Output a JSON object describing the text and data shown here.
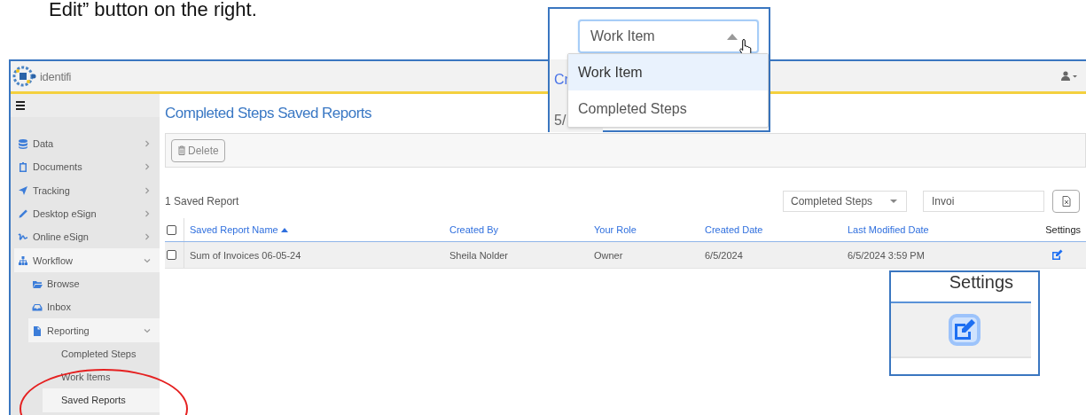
{
  "instruction_text": "Edit” button on the right.",
  "app": {
    "logo_text": "identifi",
    "sidebar": {
      "items": [
        {
          "label": "Data",
          "expanded": false,
          "selected": false
        },
        {
          "label": "Documents",
          "expanded": false,
          "selected": false
        },
        {
          "label": "Tracking",
          "expanded": false,
          "selected": false
        },
        {
          "label": "Desktop eSign",
          "expanded": false,
          "selected": false
        },
        {
          "label": "Online eSign",
          "expanded": false,
          "selected": false
        },
        {
          "label": "Workflow",
          "expanded": true,
          "selected": false,
          "children": [
            {
              "label": "Browse",
              "selected": false
            },
            {
              "label": "Inbox",
              "selected": false
            },
            {
              "label": "Reporting",
              "expanded": true,
              "selected": false,
              "children": [
                {
                  "label": "Completed Steps",
                  "selected": false
                },
                {
                  "label": "Work Items",
                  "selected": false
                },
                {
                  "label": "Saved Reports",
                  "selected": true
                }
              ]
            }
          ]
        }
      ]
    },
    "page_title": "Completed Steps Saved Reports",
    "toolbar": {
      "buttons": [
        {
          "label": "Delete",
          "disabled": true
        }
      ]
    },
    "report_count": "1 Saved Report",
    "type_filter": {
      "value": "Completed Steps"
    },
    "search": {
      "value": "Invoi"
    },
    "table": {
      "columns": [
        {
          "label": "Saved Report Name",
          "sorted": true
        },
        {
          "label": "Created By",
          "sorted": false
        },
        {
          "label": "Your Role",
          "sorted": false
        },
        {
          "label": "Created Date",
          "sorted": false
        },
        {
          "label": "Last Modified Date",
          "sorted": false
        },
        {
          "label": "Settings"
        }
      ],
      "header_checked": false,
      "rows": [
        {
          "checked": false,
          "cells": [
            "Sum of Invoices 06-05-24",
            "Sheila Nolder",
            "Owner",
            "6/5/2024",
            "6/5/2024 3:59 PM"
          ]
        }
      ]
    }
  },
  "callouts": [
    {
      "kind": "dropdown",
      "fragments": [
        "Cr",
        "5/"
      ],
      "value": "Work Item",
      "expanded": true,
      "options": [
        {
          "label": "Work Item",
          "selected": true
        },
        {
          "label": "Completed Steps",
          "selected": false
        }
      ]
    },
    {
      "kind": "settings",
      "header": "Settings"
    }
  ]
}
